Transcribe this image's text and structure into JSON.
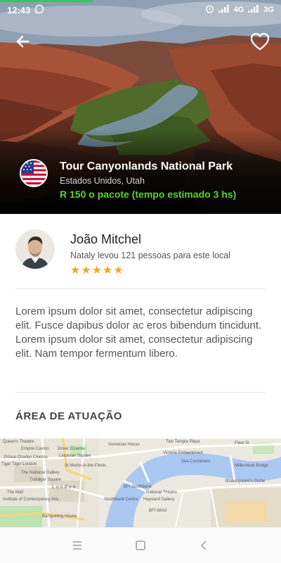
{
  "status_bar": {
    "time": "12:43",
    "network_1": "4G",
    "network_2": "3G",
    "load_progress": 0.33
  },
  "hero": {
    "title": "Tour Canyonlands National Park",
    "location": "Estados Unidos, Utah",
    "price": "R 150 o pacote (tempo estimado 3 hs)",
    "flag_icon": "usa-flag-icon",
    "price_color": "#5ed131"
  },
  "guide": {
    "name": "João Mitchel",
    "subtitle": "Nataly levou 121 pessoas para este local",
    "rating": 5,
    "rating_max": 5,
    "stars": "★★★★★",
    "star_color": "#f5a623"
  },
  "description": "Lorem ipsum dolor sit amet, consectetur adipiscing elit. Fusce dapibus dolor ac eros bibendum tincidunt. Lorem ipsum dolor sit amet, consectetur adipiscing elit. Nam tempor fermentum libero.",
  "section": {
    "title": "ÁREA DE ATUAÇÃO"
  },
  "map": {
    "labels": [
      "Queen's Theatre",
      "Empire Casino",
      "Dover Cinema",
      "Leicester Square",
      "Somerset House",
      "Two Temple Place",
      "Fleet St",
      "Prince Charles Cinema",
      "Tiger Tiger London",
      "St Martin-in-the-Fields",
      "Victoria Embankment",
      "Sea Containers",
      "Millennium Bridge",
      "The National Gallery",
      "Trafalgar Square",
      "London",
      "BFI Southbank",
      "National Theatre",
      "Shakespeare's Globe",
      "Institute of Contemporary Arts",
      "Southbank Centre",
      "Hayward Gallery",
      "BFI IMAX",
      "Banqueting House",
      "The Mall"
    ]
  },
  "nav": {
    "menu_icon": "menu-icon",
    "home_icon": "square-home-icon",
    "back_icon": "triangle-back-icon"
  }
}
